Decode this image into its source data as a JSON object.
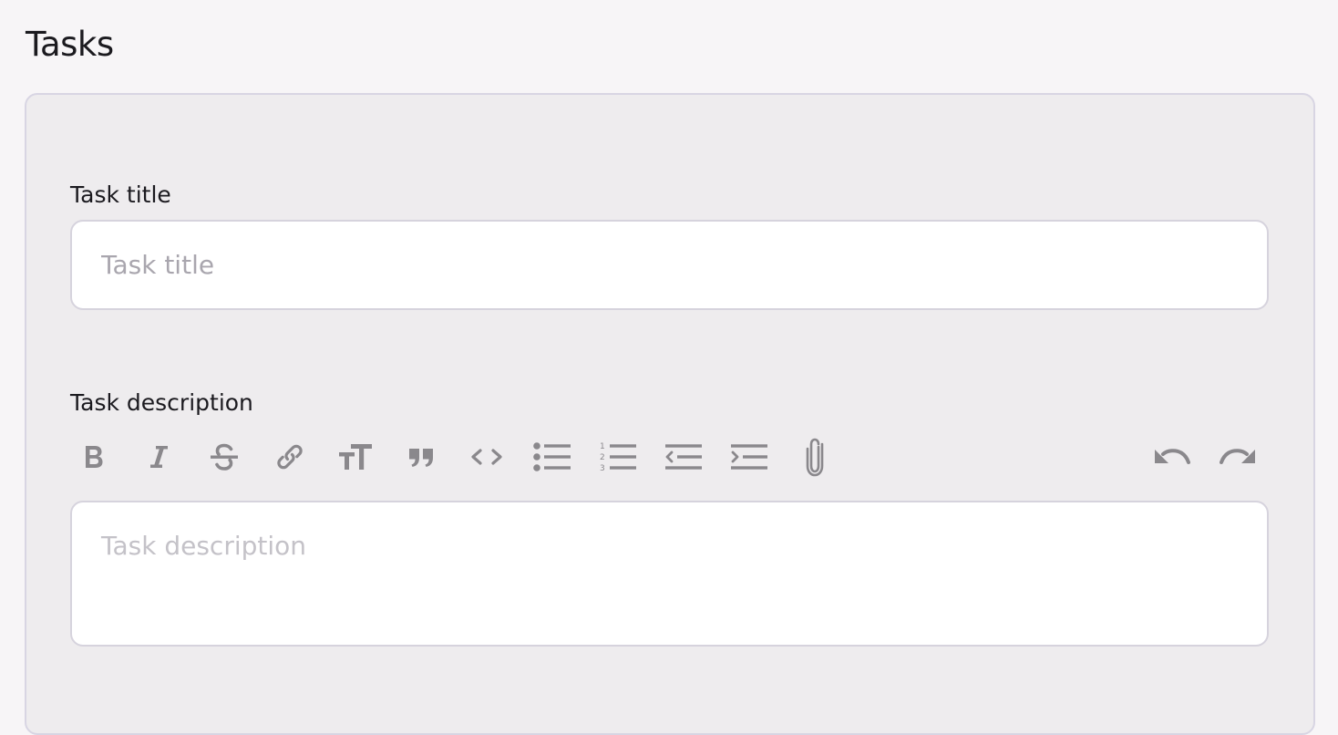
{
  "header": {
    "title": "Tasks"
  },
  "form": {
    "title_label": "Task title",
    "title_placeholder": "Task title",
    "title_value": "",
    "description_label": "Task description",
    "description_placeholder": "Task description"
  },
  "toolbar": {
    "icons": [
      "bold-icon",
      "italic-icon",
      "strikethrough-icon",
      "link-icon",
      "heading-icon",
      "quote-icon",
      "code-icon",
      "bullet-list-icon",
      "numbered-list-icon",
      "outdent-icon",
      "indent-icon",
      "attach-icon",
      "undo-icon",
      "redo-icon"
    ]
  },
  "colors": {
    "page_bg": "#f7f5f7",
    "card_bg": "#eeecee",
    "border": "#d6d3dd",
    "icon": "#8a888c",
    "placeholder": "#a9a6ae"
  }
}
